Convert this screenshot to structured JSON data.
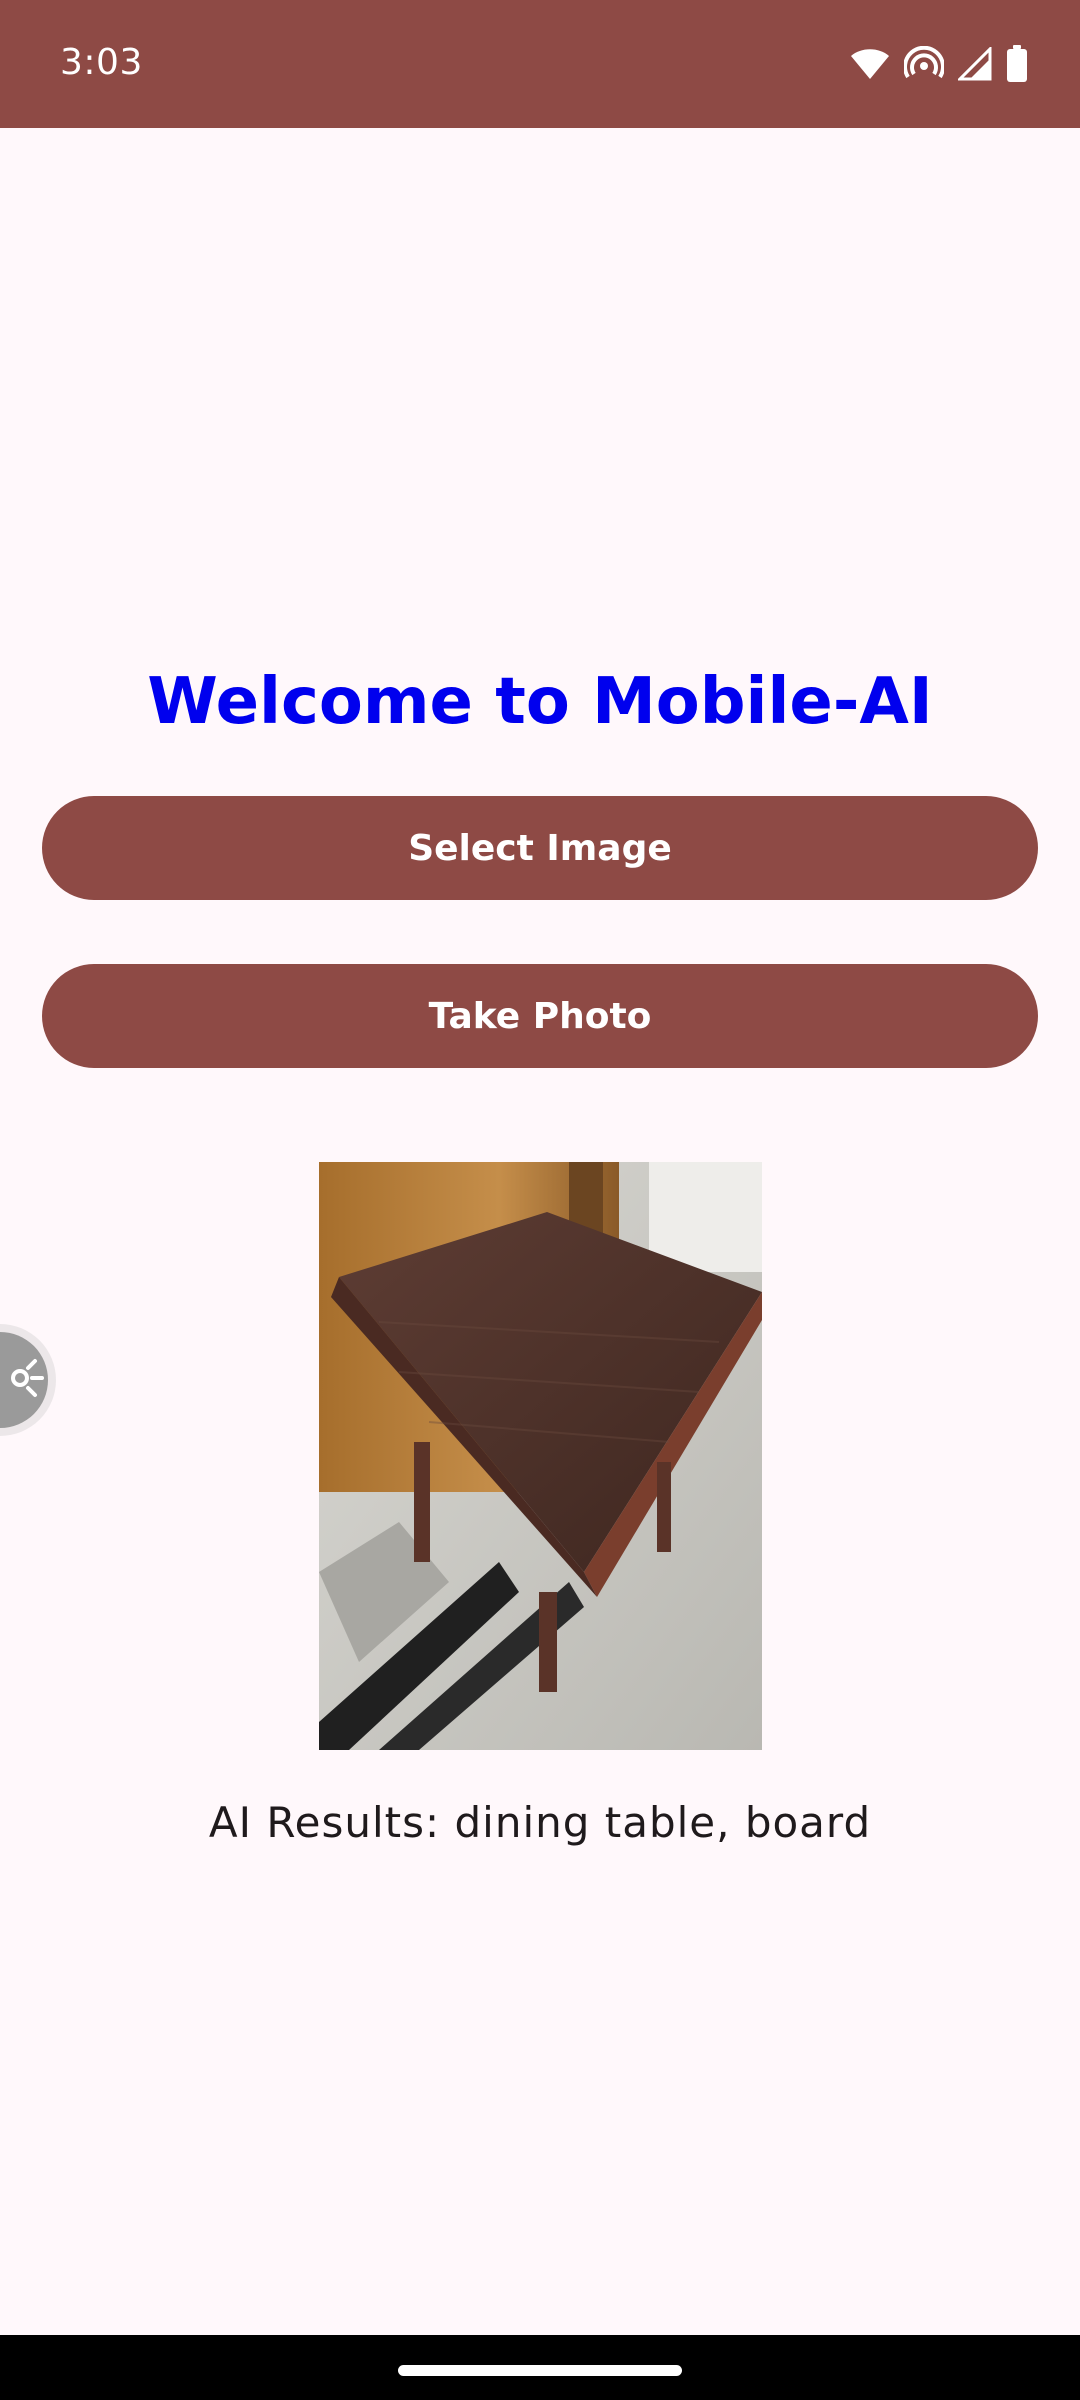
{
  "status_bar": {
    "time": "3:03",
    "icons": [
      "wifi-icon",
      "hotspot-icon",
      "signal-icon",
      "battery-icon"
    ],
    "background": "#8E4A45"
  },
  "main": {
    "title": "Welcome to Mobile-AI",
    "title_color": "#0000EE",
    "select_image_label": "Select Image",
    "take_photo_label": "Take Photo",
    "button_color": "#8E4A45",
    "preview_image": "wooden-table-photo",
    "results_text": "AI Results: dining table, board"
  },
  "floating_tool": {
    "icon": "sparkle-icon"
  },
  "navigation": {
    "handle": "home-handle"
  }
}
